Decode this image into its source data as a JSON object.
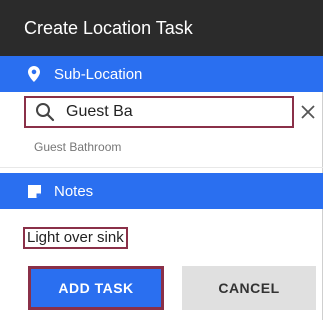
{
  "dialog": {
    "title": "Create Location Task"
  },
  "sub_location": {
    "header_label": "Sub-Location",
    "header_icon": "location-pin-icon",
    "search_value": "Guest Ba",
    "search_placeholder": "",
    "search_icon": "search-icon",
    "clear_icon": "close-icon",
    "suggestions": [
      "Guest Bathroom"
    ]
  },
  "notes": {
    "header_label": "Notes",
    "header_icon": "note-icon",
    "value": "Light over sink"
  },
  "actions": {
    "add_label": "ADD TASK",
    "cancel_label": "CANCEL"
  },
  "colors": {
    "titlebar": "#2b2b2b",
    "accent": "#2a6ff0",
    "highlight": "#8a3048"
  }
}
